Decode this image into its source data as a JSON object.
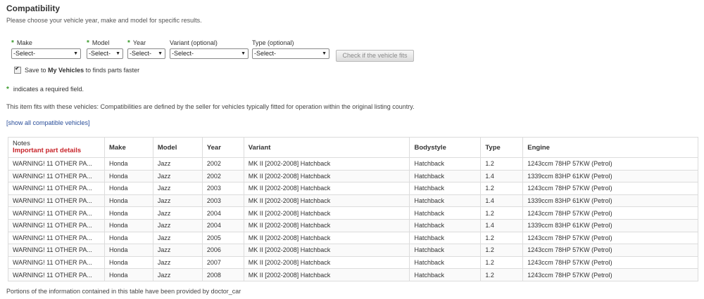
{
  "header": {
    "title": "Compatibility",
    "subtitle": "Please choose your vehicle year, make and model for specific results."
  },
  "selectors": [
    {
      "label": "Make",
      "required": "*",
      "value": "-Select-"
    },
    {
      "label": "Model",
      "required": "*",
      "value": "-Select-"
    },
    {
      "label": "Year",
      "required": "*",
      "value": "-Select-"
    },
    {
      "label": "Variant (optional)",
      "required": "",
      "value": "-Select-"
    },
    {
      "label": "Type (optional)",
      "required": "",
      "value": "-Select-"
    }
  ],
  "check_button_label": "Check if the vehicle fits",
  "save": {
    "prefix": "Save to ",
    "bold": "My Vehicles",
    "suffix": " to finds parts faster",
    "checked": true
  },
  "required_note": {
    "star": "*",
    "text": "indicates a required field."
  },
  "fits_text": "This item fits with these vehicles: Compatibilities are defined by the seller for vehicles typically fitted for operation within the original listing country.",
  "show_all_link": "[show all compatible vehicles]",
  "table": {
    "notes_header": "Notes",
    "notes_subheader": "Important part details",
    "columns": [
      "Make",
      "Model",
      "Year",
      "Variant",
      "Bodystyle",
      "Type",
      "Engine"
    ],
    "rows": [
      [
        "WARNING! 11 OTHER PA...",
        "Honda",
        "Jazz",
        "2002",
        "MK II [2002-2008] Hatchback",
        "Hatchback",
        "1.2",
        "1243ccm 78HP 57KW (Petrol)"
      ],
      [
        "WARNING! 11 OTHER PA...",
        "Honda",
        "Jazz",
        "2002",
        "MK II [2002-2008] Hatchback",
        "Hatchback",
        "1.4",
        "1339ccm 83HP 61KW (Petrol)"
      ],
      [
        "WARNING! 11 OTHER PA...",
        "Honda",
        "Jazz",
        "2003",
        "MK II [2002-2008] Hatchback",
        "Hatchback",
        "1.2",
        "1243ccm 78HP 57KW (Petrol)"
      ],
      [
        "WARNING! 11 OTHER PA...",
        "Honda",
        "Jazz",
        "2003",
        "MK II [2002-2008] Hatchback",
        "Hatchback",
        "1.4",
        "1339ccm 83HP 61KW (Petrol)"
      ],
      [
        "WARNING! 11 OTHER PA...",
        "Honda",
        "Jazz",
        "2004",
        "MK II [2002-2008] Hatchback",
        "Hatchback",
        "1.2",
        "1243ccm 78HP 57KW (Petrol)"
      ],
      [
        "WARNING! 11 OTHER PA...",
        "Honda",
        "Jazz",
        "2004",
        "MK II [2002-2008] Hatchback",
        "Hatchback",
        "1.4",
        "1339ccm 83HP 61KW (Petrol)"
      ],
      [
        "WARNING! 11 OTHER PA...",
        "Honda",
        "Jazz",
        "2005",
        "MK II [2002-2008] Hatchback",
        "Hatchback",
        "1.2",
        "1243ccm 78HP 57KW (Petrol)"
      ],
      [
        "WARNING! 11 OTHER PA...",
        "Honda",
        "Jazz",
        "2006",
        "MK II [2002-2008] Hatchback",
        "Hatchback",
        "1.2",
        "1243ccm 78HP 57KW (Petrol)"
      ],
      [
        "WARNING! 11 OTHER PA...",
        "Honda",
        "Jazz",
        "2007",
        "MK II [2002-2008] Hatchback",
        "Hatchback",
        "1.2",
        "1243ccm 78HP 57KW (Petrol)"
      ],
      [
        "WARNING! 11 OTHER PA...",
        "Honda",
        "Jazz",
        "2008",
        "MK II [2002-2008] Hatchback",
        "Hatchback",
        "1.2",
        "1243ccm 78HP 57KW (Petrol)"
      ]
    ]
  },
  "footer": "Portions of the information contained in this table have been provided by doctor_car",
  "colors": {
    "required_star": "#3a9a2a",
    "important_red": "#c8242a",
    "link_blue": "#2a4e9a"
  }
}
